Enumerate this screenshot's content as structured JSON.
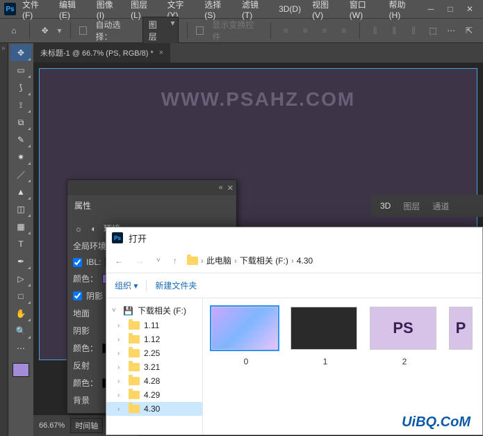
{
  "titlebar": {
    "menus": [
      "文件(F)",
      "编辑(E)",
      "图像(I)",
      "图层(L)",
      "文字(Y)",
      "选择(S)",
      "滤镜(T)",
      "3D(D)",
      "视图(V)",
      "窗口(W)",
      "帮助(H)"
    ]
  },
  "options": {
    "auto_select_label": "自动选择：",
    "layer_select": "图层",
    "show_transform": "显示变换控件"
  },
  "document": {
    "tab_title": "未标题-1 @ 66.7% (PS, RGB/8) *",
    "watermark": "WWW.PSAHZ.COM",
    "zoom": "66.67%",
    "timeline_btn": "时间轴"
  },
  "props": {
    "tab": "属性",
    "env_label": "环境",
    "global_label": "全局环境",
    "ibl_label": "IBL:",
    "color_label": "颜色：",
    "shadow_check": "阴影",
    "ground": "地面",
    "ground_shadow": "阴影",
    "reflect": "反射",
    "bg_label": "背景"
  },
  "right_tabs": [
    "3D",
    "图层",
    "通道"
  ],
  "open_dialog": {
    "title": "打开",
    "crumbs": [
      "此电脑",
      "下载相关 (F:)",
      "4.30"
    ],
    "organize": "组织",
    "new_folder": "新建文件夹",
    "drive_label": "下载相关 (F:)",
    "folders": [
      "1.11",
      "1.12",
      "2.25",
      "3.21",
      "4.28",
      "4.29",
      "4.30"
    ],
    "thumbs": [
      {
        "label": "0"
      },
      {
        "label": "1"
      },
      {
        "label": "2"
      }
    ]
  },
  "brand": "UiBQ.CoM"
}
